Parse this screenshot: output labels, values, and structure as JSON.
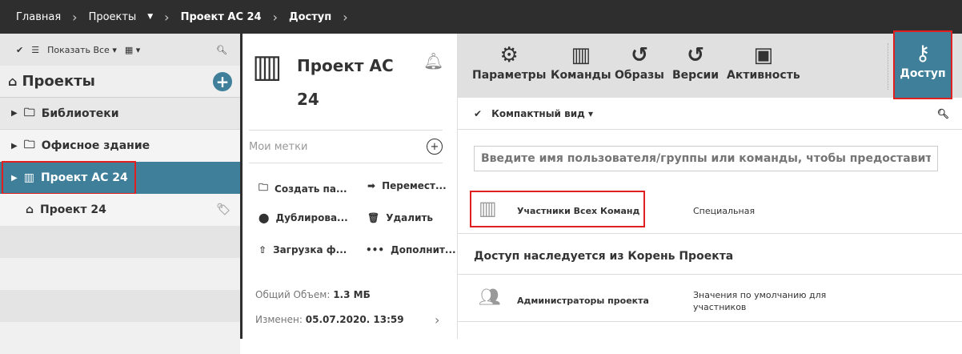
{
  "breadcrumb": [
    "Главная",
    "Проекты",
    "Проект АС 24",
    "Доступ"
  ],
  "left": {
    "show_all": "Показать Все",
    "title": "Проекты",
    "items": [
      {
        "label": "Библиотеки"
      },
      {
        "label": "Офисное здание"
      },
      {
        "label": "Проект АС 24"
      },
      {
        "label": "Проект 24"
      }
    ]
  },
  "mid": {
    "title_line1": "Проект АС",
    "title_line2": "24",
    "tags_label": "Мои метки",
    "actions": [
      "Создать па...",
      "Перемест...",
      "Дублирова...",
      "Удалить",
      "Загрузка ф...",
      "Дополнит..."
    ],
    "size_label": "Общий Объем:",
    "size_value": "1.3 МБ",
    "modified_label": "Изменен:",
    "modified_value": "05.07.2020. 13:59"
  },
  "right": {
    "tools": [
      "Параметры",
      "Команды",
      "Образы",
      "Версии",
      "Активность"
    ],
    "access": "Доступ",
    "compact": "Компактный вид",
    "search_placeholder": "Введите имя пользователя/группы или команды, чтобы предоставить доступ",
    "entries": [
      {
        "name": "Участники Всех Команд",
        "role": "Специальная"
      }
    ],
    "inherited": "Доступ наследуется из Корень Проекта",
    "inherited_entries": [
      {
        "name": "Администраторы проекта",
        "role_line1": "Значения по умолчанию для",
        "role_line2": "участников"
      }
    ]
  },
  "colors": {
    "accent": "#3f7f9a",
    "topbar": "#2e2e2e"
  }
}
